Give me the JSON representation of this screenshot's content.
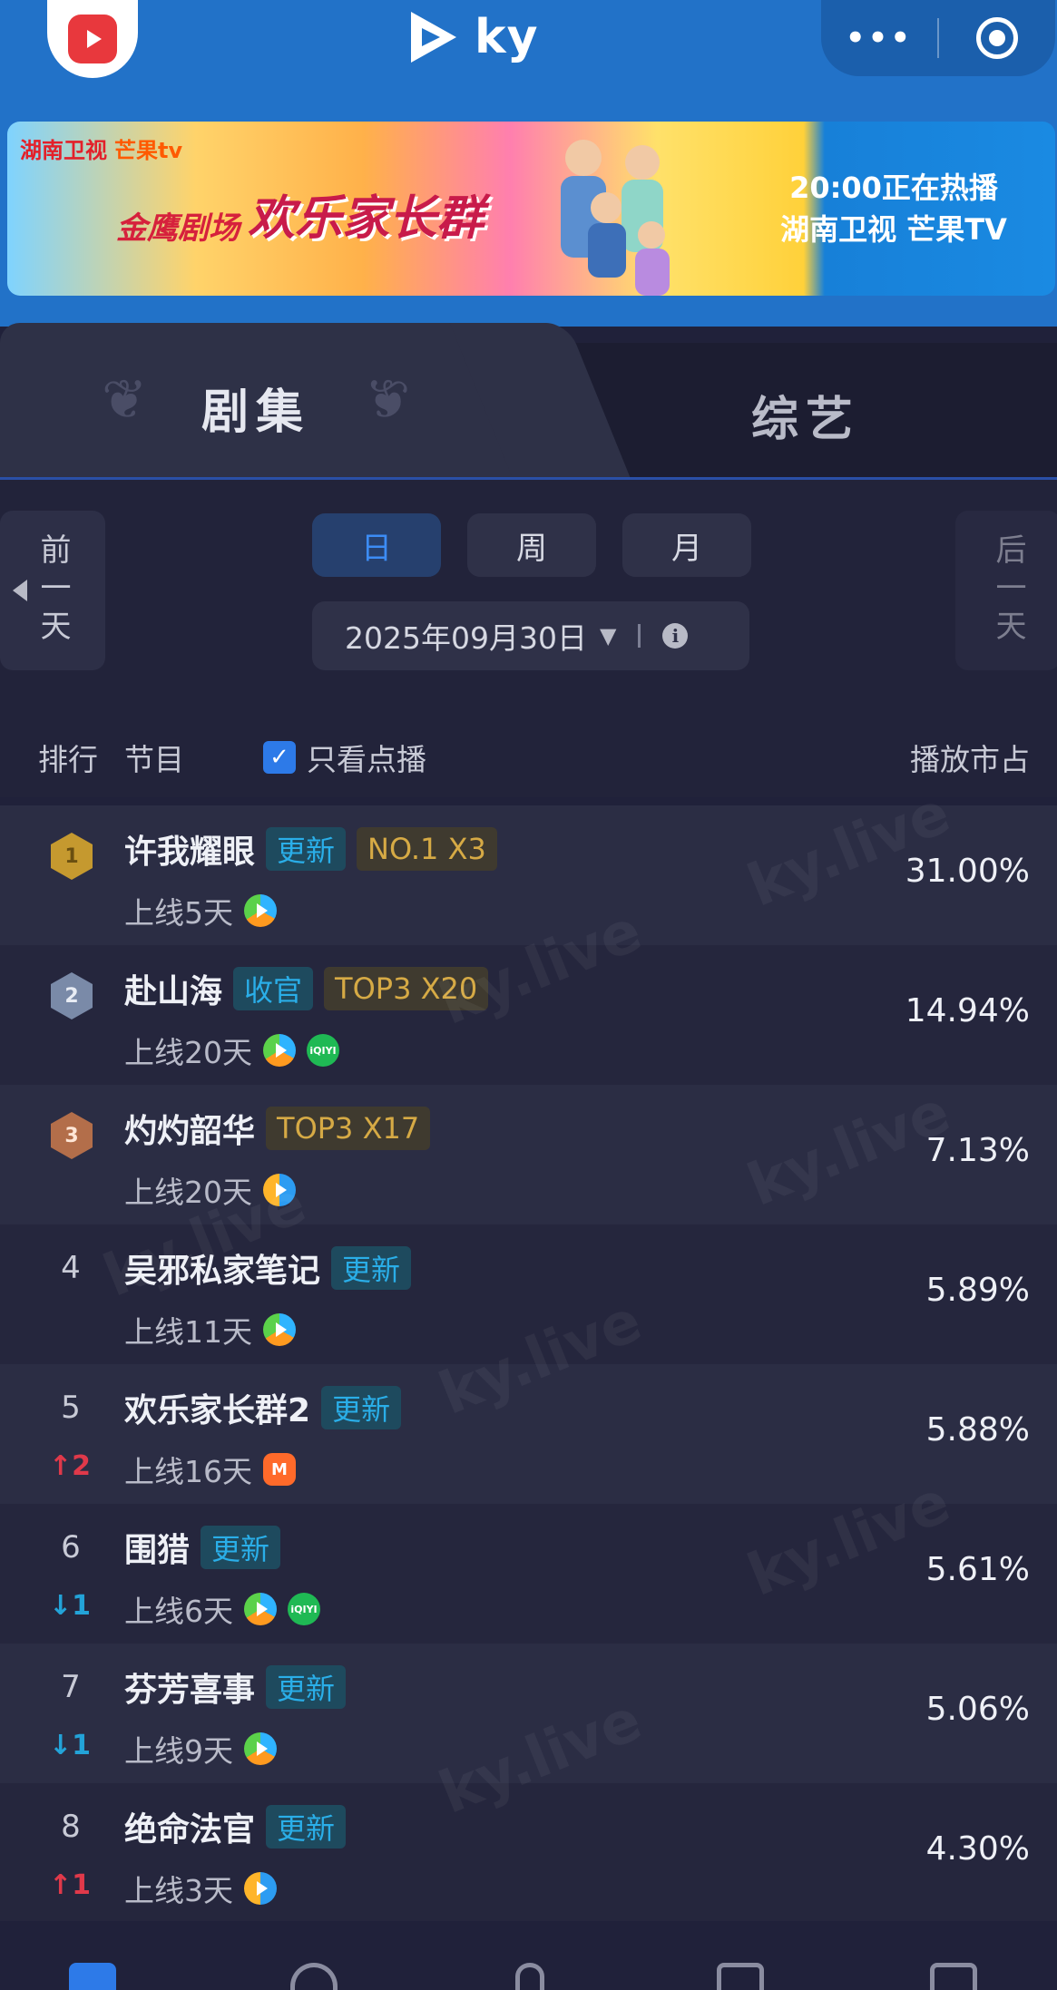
{
  "topbar": {
    "brand": "ky",
    "more_label": "•••"
  },
  "banner": {
    "logo_hunan": "湖南卫视",
    "logo_mango": "芒果tv",
    "theater": "金鹰剧场",
    "show_title": "欢乐家长群",
    "airing_time": "20:00正在热播",
    "airing_channels": "湖南卫视 芒果TV"
  },
  "tabs": {
    "series": "剧集",
    "variety": "综艺"
  },
  "filter": {
    "prev_day": "前一天",
    "next_day": "后一天",
    "periods": [
      "日",
      "周",
      "月"
    ],
    "active_period": "日",
    "date": "2025年09月30日"
  },
  "list_header": {
    "rank": "排行",
    "program": "节目",
    "vod_only": "只看点播",
    "vod_only_checked": true,
    "share": "播放市占"
  },
  "rows": [
    {
      "rank": "1",
      "medal": "gold",
      "title": "许我耀眼",
      "tags": [
        {
          "text": "更新",
          "kind": "update"
        },
        {
          "text": "NO.1 X3",
          "kind": "gold"
        }
      ],
      "trend": "",
      "trend_dir": "",
      "days": "上线5天",
      "platforms": [
        "tencent"
      ],
      "share": "31.00%"
    },
    {
      "rank": "2",
      "medal": "silver",
      "title": "赴山海",
      "tags": [
        {
          "text": "收官",
          "kind": "final"
        },
        {
          "text": "TOP3 X20",
          "kind": "gold"
        }
      ],
      "trend": "",
      "trend_dir": "",
      "days": "上线20天",
      "platforms": [
        "tencent",
        "iqiyi"
      ],
      "share": "14.94%"
    },
    {
      "rank": "3",
      "medal": "bronze",
      "title": "灼灼韶华",
      "tags": [
        {
          "text": "TOP3 X17",
          "kind": "gold"
        }
      ],
      "trend": "",
      "trend_dir": "",
      "days": "上线20天",
      "platforms": [
        "youku"
      ],
      "share": "7.13%"
    },
    {
      "rank": "4",
      "medal": "",
      "title": "吴邪私家笔记",
      "tags": [
        {
          "text": "更新",
          "kind": "update"
        }
      ],
      "trend": "",
      "trend_dir": "",
      "days": "上线11天",
      "platforms": [
        "tencent"
      ],
      "share": "5.89%"
    },
    {
      "rank": "5",
      "medal": "",
      "title": "欢乐家长群2",
      "tags": [
        {
          "text": "更新",
          "kind": "update"
        }
      ],
      "trend": "2",
      "trend_dir": "up",
      "days": "上线16天",
      "platforms": [
        "mango"
      ],
      "share": "5.88%"
    },
    {
      "rank": "6",
      "medal": "",
      "title": "围猎",
      "tags": [
        {
          "text": "更新",
          "kind": "update"
        }
      ],
      "trend": "1",
      "trend_dir": "down",
      "days": "上线6天",
      "platforms": [
        "tencent",
        "iqiyi"
      ],
      "share": "5.61%"
    },
    {
      "rank": "7",
      "medal": "",
      "title": "芬芳喜事",
      "tags": [
        {
          "text": "更新",
          "kind": "update"
        }
      ],
      "trend": "1",
      "trend_dir": "down",
      "days": "上线9天",
      "platforms": [
        "tencent"
      ],
      "share": "5.06%"
    },
    {
      "rank": "8",
      "medal": "",
      "title": "绝命法官",
      "tags": [
        {
          "text": "更新",
          "kind": "update"
        }
      ],
      "trend": "1",
      "trend_dir": "up",
      "days": "上线3天",
      "platforms": [
        "youku"
      ],
      "share": "4.30%"
    }
  ],
  "watermark": "ky.live",
  "colors": {
    "accent": "#2272c8",
    "background": "#20213a",
    "update_tag": "#2aaee8",
    "gold_tag": "#d6aa45",
    "trend_up": "#e0394a",
    "trend_down": "#23a3d8"
  }
}
